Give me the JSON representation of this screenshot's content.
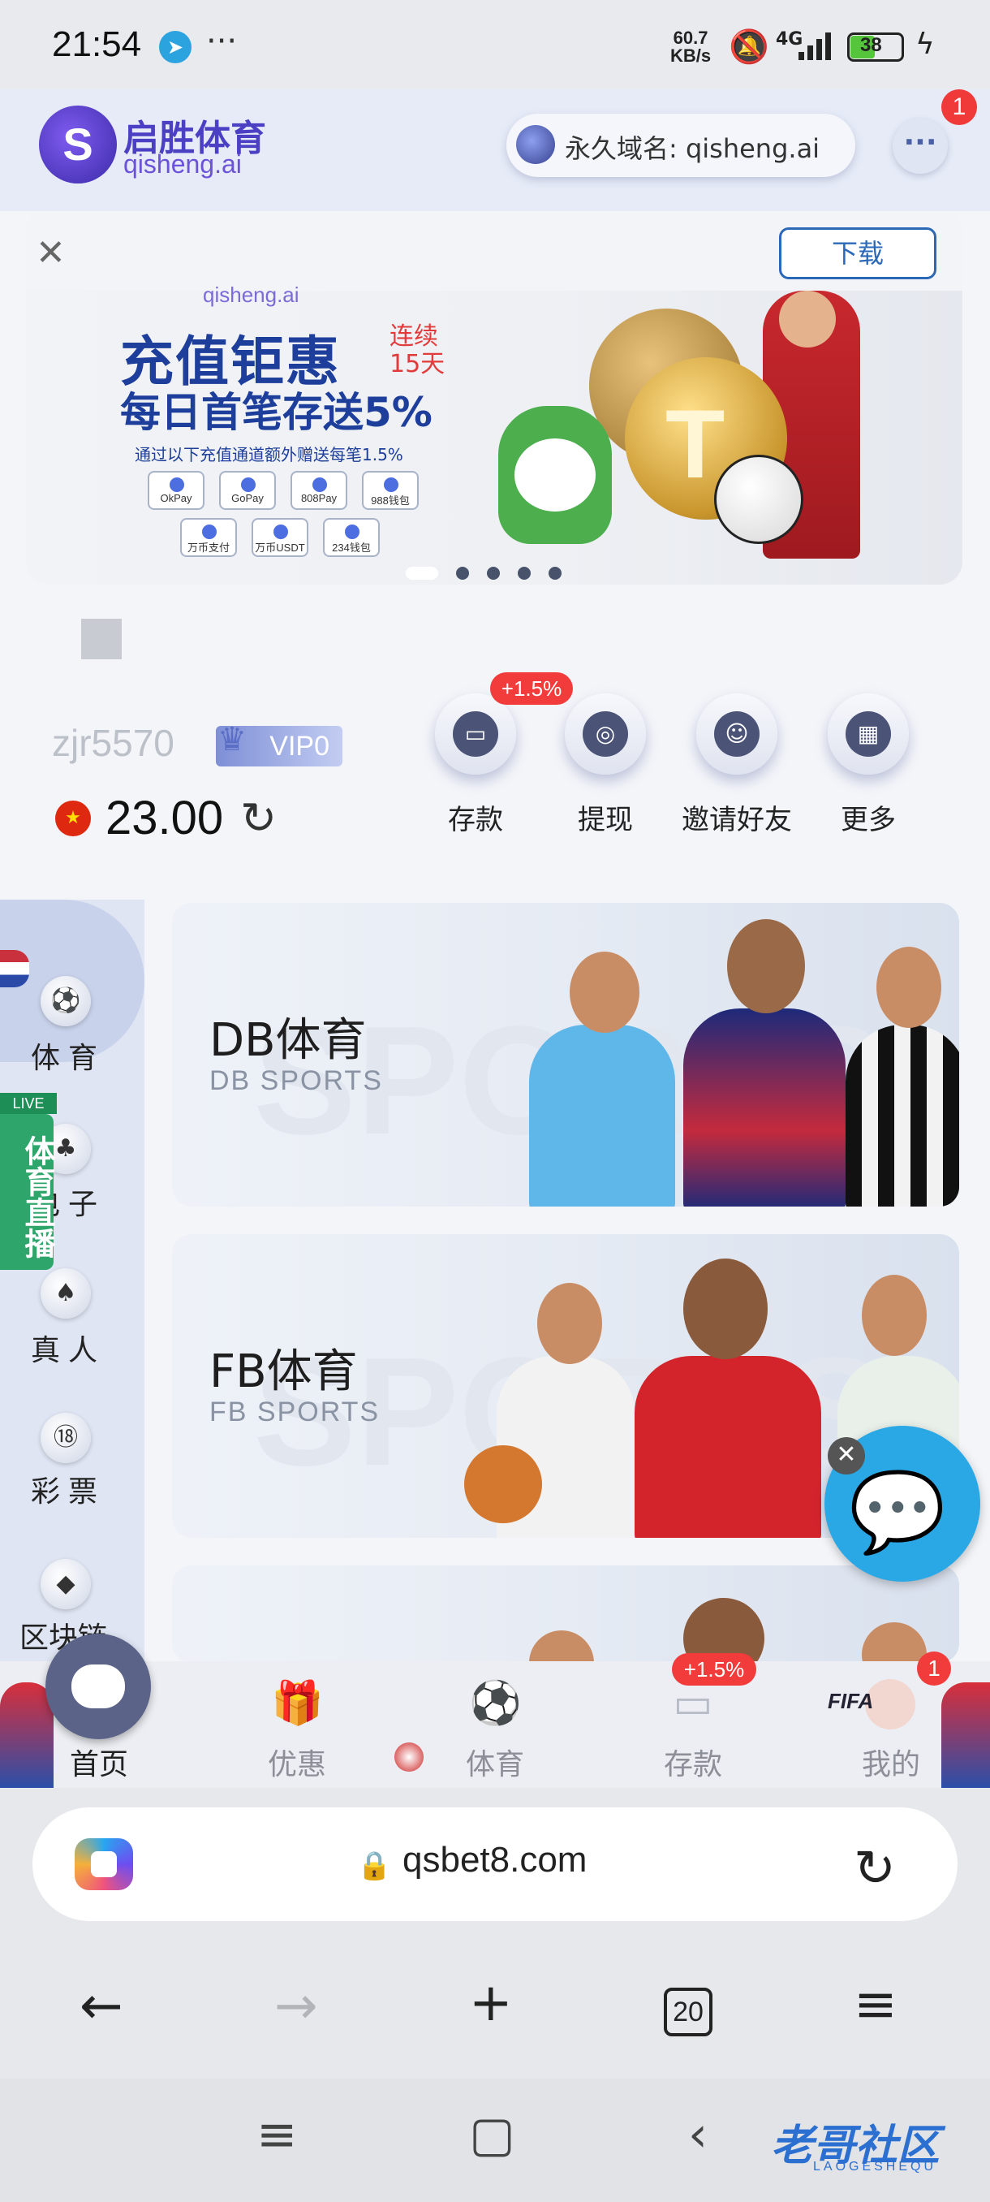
{
  "status_bar": {
    "time": "21:54",
    "more": "···",
    "net_speed_value": "60.7",
    "net_speed_unit": "KB/s",
    "signal_label": "4G",
    "battery": "38"
  },
  "header": {
    "logo_cn": "启胜体育",
    "logo_en": "qisheng.ai",
    "domain_label": "永久域名: qisheng.ai",
    "chat_badge": "1"
  },
  "download_bar": {
    "button_label": "下载"
  },
  "banner": {
    "brand": "qisheng.ai",
    "title": "充值钜惠",
    "badge": "连续15天",
    "subtitle": "每日首笔存送5%",
    "note": "通过以下充值通道额外赠送每笔1.5%",
    "payments": [
      "OkPay",
      "GoPay",
      "808Pay",
      "988钱包",
      "万币支付",
      "万币USDT",
      "234钱包"
    ],
    "slides_total": 5,
    "active_slide": 1
  },
  "user": {
    "username": "zjr5570",
    "vip_level": "VIP0",
    "balance": "23.00"
  },
  "quick_actions": [
    {
      "label": "存款",
      "icon": "deposit-icon",
      "badge": "+1.5%"
    },
    {
      "label": "提现",
      "icon": "withdraw-icon"
    },
    {
      "label": "邀请好友",
      "icon": "invite-icon"
    },
    {
      "label": "更多",
      "icon": "more-grid-icon"
    }
  ],
  "side_nav": {
    "items": [
      "体育",
      "电子",
      "真人",
      "彩票",
      "区块链"
    ],
    "live_tab": "体育直播",
    "live_tag": "LIVE"
  },
  "game_cards": [
    {
      "title": "DB体育",
      "subtitle": "DB SPORTS"
    },
    {
      "title": "FB体育",
      "subtitle": "FB SPORTS"
    }
  ],
  "tab_bar": {
    "items": [
      "首页",
      "优惠",
      "体育",
      "存款",
      "我的"
    ],
    "deposit_badge": "+1.5%",
    "me_badge": "1",
    "active": "首页"
  },
  "browser": {
    "url": "qsbet8.com",
    "tab_count": "20"
  },
  "watermark": {
    "text": "老哥社区",
    "sub": "LAOGESHEQU"
  }
}
